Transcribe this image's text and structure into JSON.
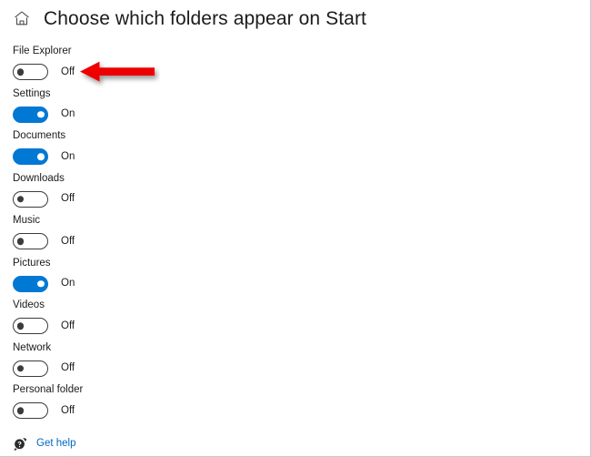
{
  "header": {
    "home_icon": "home-icon",
    "title": "Choose which folders appear on Start"
  },
  "folders": [
    {
      "label": "File Explorer",
      "state": "Off",
      "on": false
    },
    {
      "label": "Settings",
      "state": "On",
      "on": true
    },
    {
      "label": "Documents",
      "state": "On",
      "on": true
    },
    {
      "label": "Downloads",
      "state": "Off",
      "on": false
    },
    {
      "label": "Music",
      "state": "Off",
      "on": false
    },
    {
      "label": "Pictures",
      "state": "On",
      "on": true
    },
    {
      "label": "Videos",
      "state": "Off",
      "on": false
    },
    {
      "label": "Network",
      "state": "Off",
      "on": false
    },
    {
      "label": "Personal folder",
      "state": "Off",
      "on": false
    }
  ],
  "footer": {
    "help_icon": "help-question-bubble-icon",
    "help_label": "Get help"
  },
  "annotation": {
    "arrow_icon": "red-left-arrow-annotation",
    "color": "#ee0000",
    "points_at": "File Explorer"
  },
  "colors": {
    "accent": "#0078d4",
    "link": "#0067c0",
    "text": "#1b1b1b",
    "toggle_off_border": "#3b3b3b",
    "annotation_red": "#ee0000"
  }
}
